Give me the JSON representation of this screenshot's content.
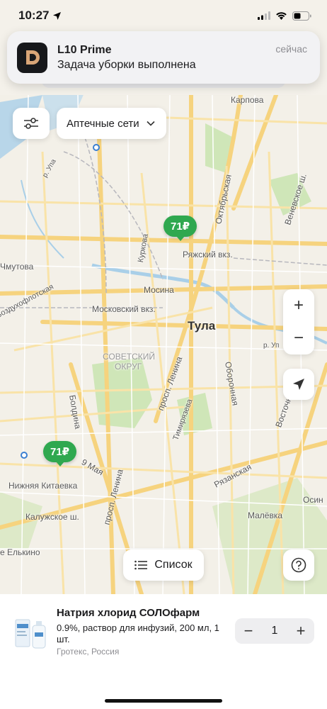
{
  "status_bar": {
    "time": "10:27"
  },
  "notification": {
    "app_name": "L10 Prime",
    "message": "Задача уборки выполнена",
    "time": "сейчас",
    "icon_letter": "D"
  },
  "map": {
    "labels": {
      "karpova": "Карпова",
      "ula_north": "р. Упа",
      "oktyabrskaya": "Октябрьская",
      "venevskoe": "Веневское ш.",
      "kurkova": "Куркова",
      "ryazhsky": "Ряжский вкз.",
      "chmutova": "Чмутова",
      "vozdukhoflotskaya": "Воздухофлотская",
      "mosina": "Мосина",
      "moskovsky": "Московский вкз.",
      "tula": "Тула",
      "sovetsky": "СОВЕТСКИЙ",
      "okrug": "ОКРУГ",
      "ula_east": "р. Уп",
      "lenina": "просп. Ленина",
      "oboronnaya": "Оборонная",
      "boldina": "Болдина",
      "timiryazeva": "Тимирязева",
      "vostochny": "Восточн",
      "may9": "9 Мая",
      "nizhnyaya": "Нижняя Китаевка",
      "ryazanskaya": "Рязанская",
      "lenina_south": "просп. Ленина",
      "kaluzhskoe": "Калужское ш.",
      "malevka": "Малёвка",
      "osin": "Осин",
      "elkino": "е Елькино"
    },
    "chains_dropdown": "Аптечные сети",
    "pins": [
      "71₽",
      "71₽"
    ],
    "list_button": "Список",
    "zoom_in": "+",
    "zoom_out": "−"
  },
  "product": {
    "name": "Натрия хлорид СОЛОфарм",
    "description": "0.9%, раствор для инфузий, 200 мл, 1 шт.",
    "manufacturer": "Гротекс, Россия",
    "quantity": "1",
    "minus": "−",
    "plus": "+"
  },
  "colors": {
    "pin_green": "#2fa84f",
    "park_green": "#cfe6b8",
    "road_yellow": "#f7d98a",
    "water": "#a9cfe8"
  }
}
